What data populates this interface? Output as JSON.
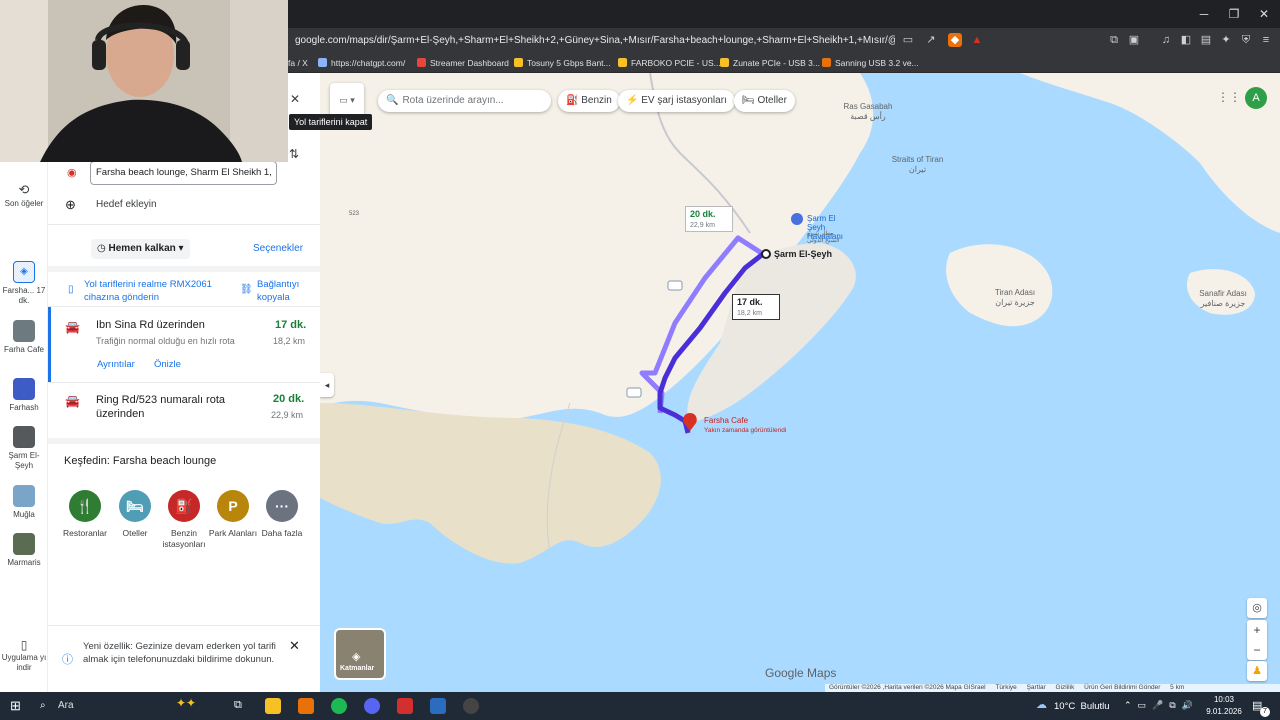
{
  "browser": {
    "url": "google.com/maps/dir/Şarm+El-Şeyh,+Sharm+El+Sheikh+2,+Güney+Sina,+Mısır/Farsha+beach+lounge,+Sharm+El+Sheikh+1,+Mısır/@27.880...",
    "tab_fragment": "fa / X",
    "bookmarks": [
      "https://chatgpt.com/",
      "Streamer Dashboard",
      "Tosuny 5 Gbps Bant...",
      "FARBOKO PCIE - US...",
      "Zunate PCIe - USB 3...",
      "Sanning USB 3.2 ve..."
    ],
    "bookmark_colors": [
      "#8ab4f8",
      "#e8453c",
      "#f6c026",
      "#f6c026",
      "#f6c026",
      "#e8710a"
    ]
  },
  "tooltip": "Yol tariflerini kapat",
  "rail": {
    "recent": "Son öğeler",
    "items": [
      {
        "label": "Farsha... 17 dk.",
        "icon": "directions-icon"
      },
      {
        "label": "Farha Cafe",
        "icon": "thumbnail"
      },
      {
        "label": "Farhash",
        "icon": "thumbnail"
      },
      {
        "label": "Şarm El-Şeyh",
        "icon": "thumbnail"
      },
      {
        "label": "Muğla",
        "icon": "thumbnail"
      },
      {
        "label": "Marmaris",
        "icon": "thumbnail"
      }
    ],
    "install": "Uygulama yı indir"
  },
  "directions": {
    "destination": "Farsha beach lounge, Sharm El Sheikh 1,",
    "add_destination": "Hedef ekleyin",
    "depart_now": "Hemen kalkan",
    "options": "Seçenekler",
    "send_to_device": "Yol tariflerini realme RMX2061 cihazına gönderin",
    "copy_link": "Bağlantıyı kopyala",
    "routes": [
      {
        "title": "Ibn Sina Rd üzerinden",
        "time": "17 dk.",
        "desc": "Trafiğin normal olduğu en hızlı rota",
        "distance": "18,2 km",
        "details": "Ayrıntılar",
        "preview": "Önizle"
      },
      {
        "title": "Ring Rd/523 numaralı rota üzerinden",
        "time": "20 dk.",
        "distance": "22,9 km"
      }
    ],
    "explore_title": "Keşfedin: Farsha beach lounge",
    "explore": [
      {
        "label": "Restoranlar",
        "color": "#2e7d32",
        "glyph": "🍴"
      },
      {
        "label": "Oteller",
        "color": "#4f9eb5",
        "glyph": "🛏"
      },
      {
        "label": "Benzin istasyonları",
        "color": "#c62828",
        "glyph": "⛽"
      },
      {
        "label": "Park Alanları",
        "color": "#b8860b",
        "glyph": "P"
      },
      {
        "label": "Daha fazla",
        "color": "#6b7280",
        "glyph": "···"
      }
    ],
    "notice": "Yeni özellik: Gezinize devam ederken yol tarifi almak için telefonunuzdaki bildirime dokunun."
  },
  "map": {
    "search_placeholder": "Rota üzerinde arayın...",
    "chips": [
      "Benzin",
      "EV şarj istasyonları",
      "Oteller"
    ],
    "labels": {
      "sharm": "Şarm El-Şeyh",
      "airport": "Şarm El Şeyh Havaalanı",
      "airport_ar": "مطار شرم الشيخ الدولي",
      "farsha": "Farsha Cafe",
      "farsha_sub": "Yakın zamanda görüntülendi",
      "ras": "Ras Gasabah",
      "ras_ar": "رأس قصبة",
      "straits": "Straits of Tiran",
      "straits_ar": "تيران",
      "tiran": "Tiran Adası",
      "tiran_ar": "جزيرة تيران",
      "sanafir": "Sanafir Adası",
      "sanafir_ar": "جزيرة صنافير",
      "road_a": "523",
      "road_b": "523"
    },
    "route_boxes": [
      {
        "time": "20 dk.",
        "dist": "22,9 km"
      },
      {
        "time": "17 dk.",
        "dist": "18,2 km"
      }
    ],
    "layers": "Katmanlar",
    "brand": "Google Maps",
    "footer": [
      "Görüntüler ©2026 ,Harita verileri ©2026 Mapa GISrael",
      "Türkiye",
      "Şartlar",
      "Gizlilik",
      "Ürün Geri Bildirimi Gönder",
      "5 km"
    ],
    "avatar": "A"
  },
  "taskbar": {
    "search": "Ara",
    "weather": "10°C  Bulutlu",
    "time": "10:03",
    "date": "9.01.2026",
    "badge": "7"
  }
}
